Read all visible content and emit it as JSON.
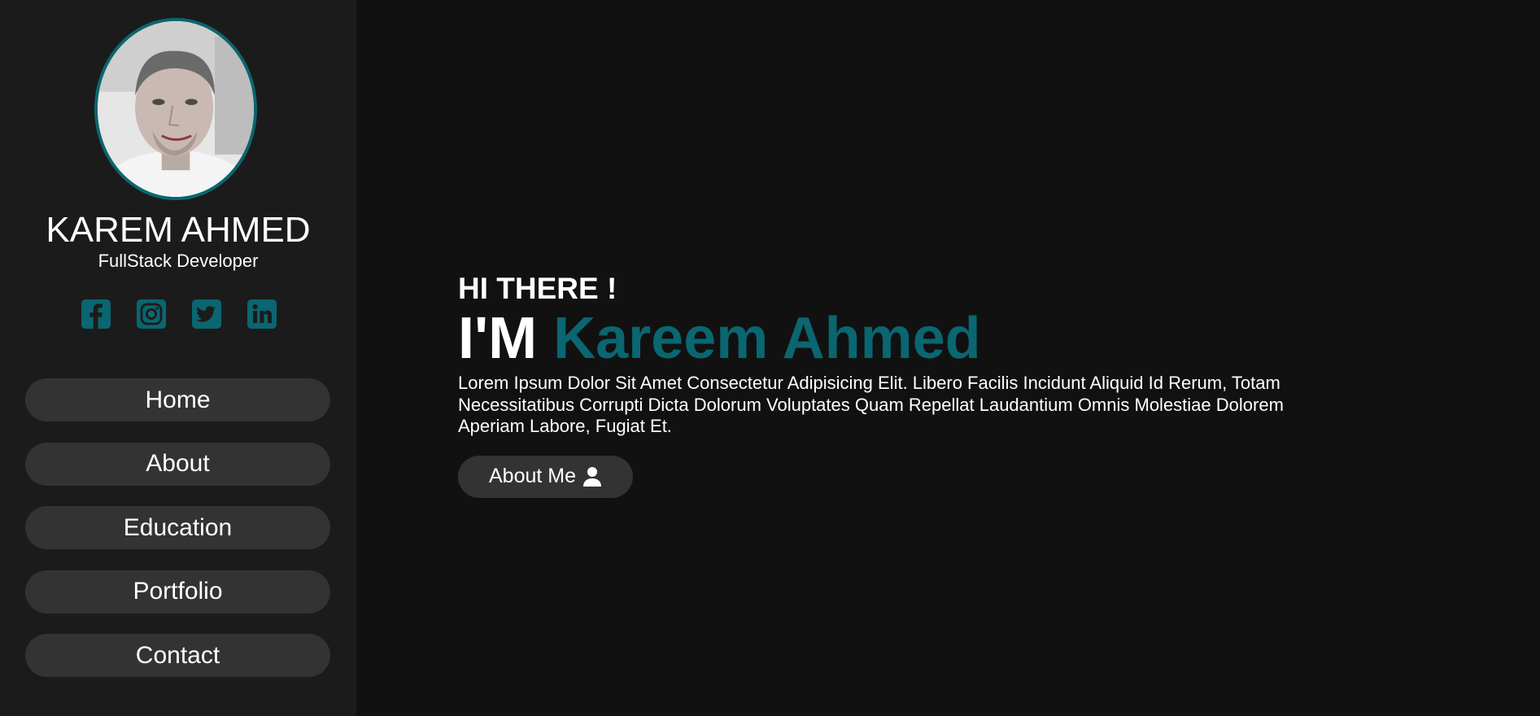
{
  "sidebar": {
    "profile": {
      "name": "KAREM AHMED",
      "role": "FullStack Developer",
      "avatar_icon": "profile-photo"
    },
    "socials": [
      {
        "label": "Facebook",
        "icon": "facebook-icon"
      },
      {
        "label": "Instagram",
        "icon": "instagram-icon"
      },
      {
        "label": "Twitter",
        "icon": "twitter-icon"
      },
      {
        "label": "LinkedIn",
        "icon": "linkedin-icon"
      }
    ],
    "nav": [
      {
        "label": "Home"
      },
      {
        "label": "About"
      },
      {
        "label": "Education"
      },
      {
        "label": "Portfolio"
      },
      {
        "label": "Contact"
      }
    ]
  },
  "hero": {
    "greeting": "HI THERE !",
    "headline_prefix": "I'M",
    "headline_name": "Kareem Ahmed",
    "description": "Lorem Ipsum Dolor Sit Amet Consectetur Adipisicing Elit. Libero Facilis Incidunt Aliquid Id Rerum, Totam Necessitatibus Corrupti Dicta Dolorum Voluptates Quam Repellat Laudantium Omnis Molestiae Dolorem Aperiam Labore, Fugiat Et.",
    "cta_label": "About Me",
    "cta_icon": "user-icon"
  },
  "colors": {
    "accent": "#0a6670",
    "background": "#111111",
    "sidebar": "#1b1b1b",
    "button": "#333333",
    "text": "#ffffff"
  }
}
